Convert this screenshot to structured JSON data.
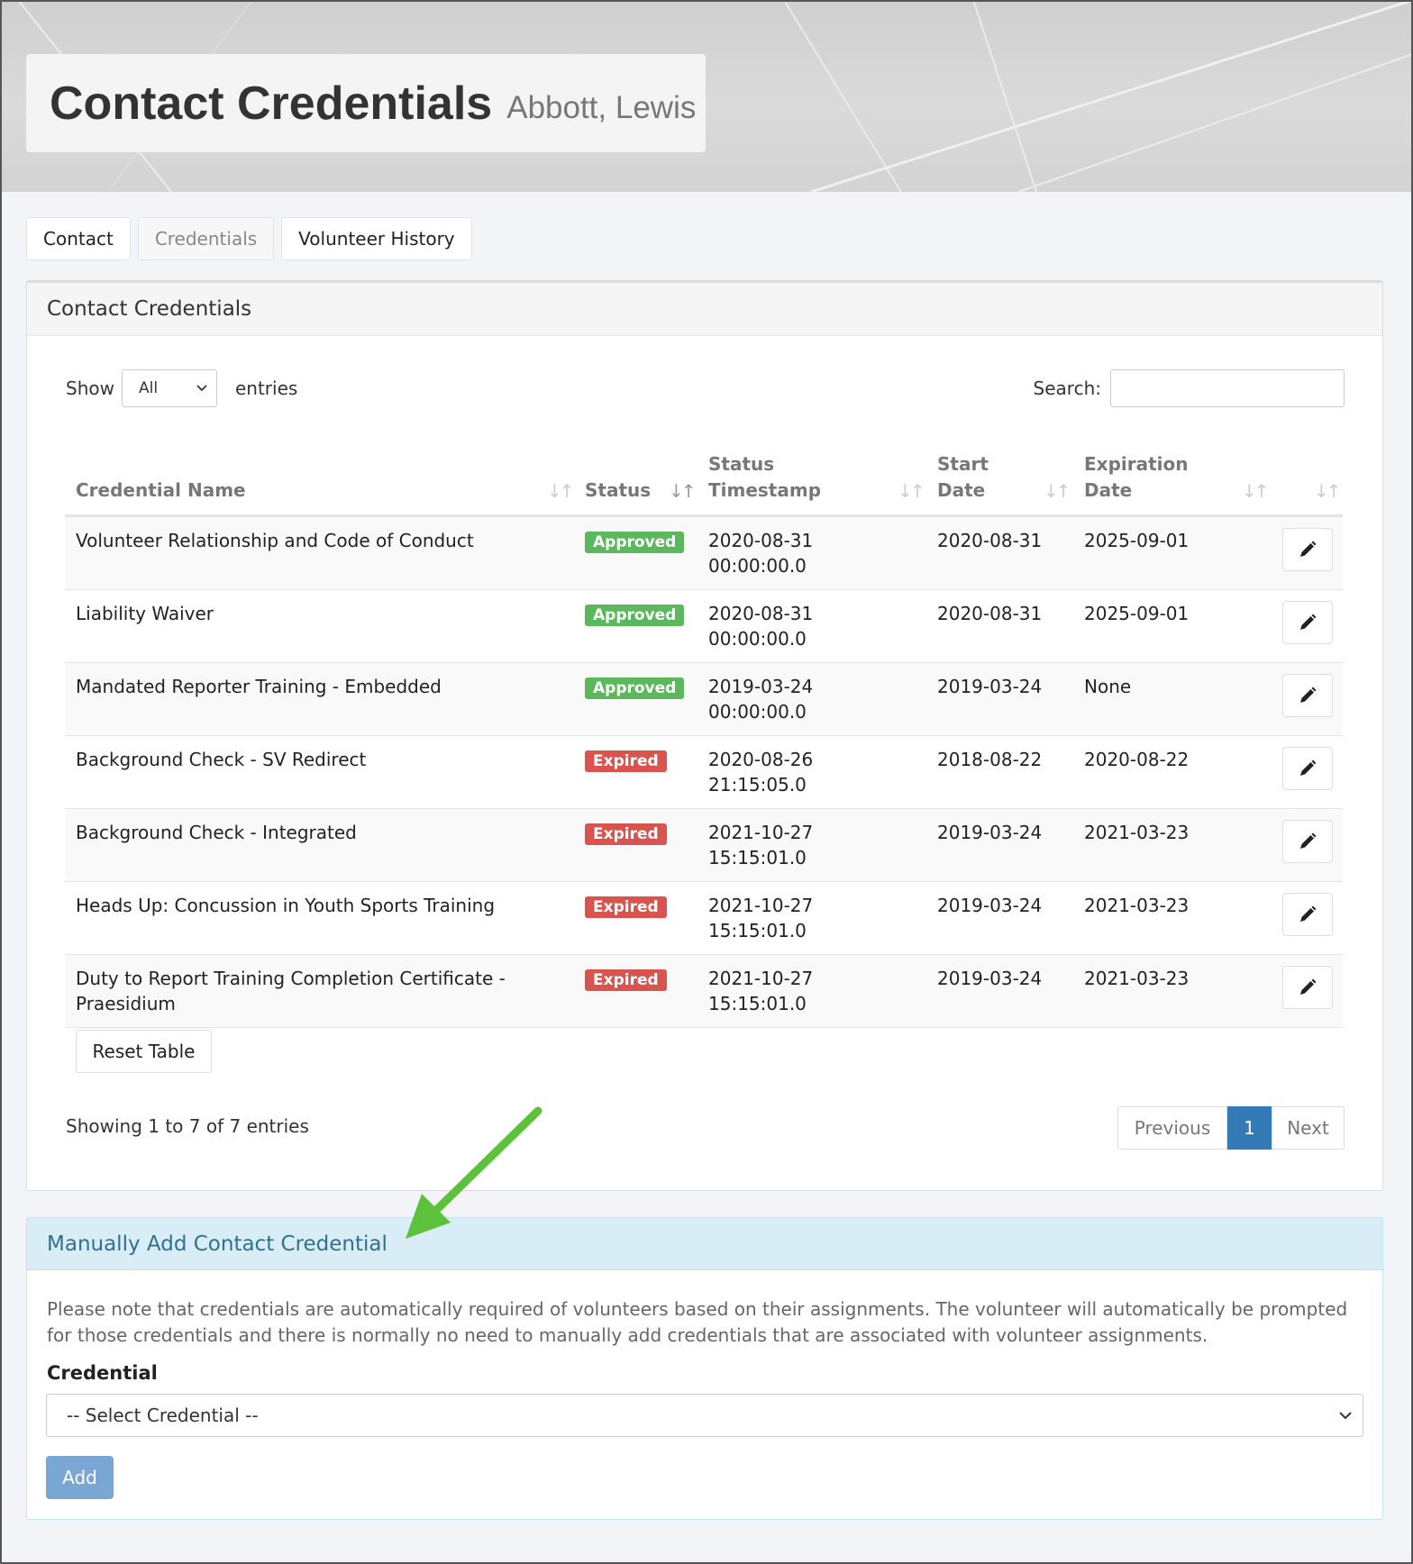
{
  "header": {
    "title": "Contact Credentials",
    "subtitle": "Abbott, Lewis"
  },
  "tabs": [
    {
      "label": "Contact",
      "active": false
    },
    {
      "label": "Credentials",
      "active": true
    },
    {
      "label": "Volunteer History",
      "active": false
    }
  ],
  "panel": {
    "title": "Contact Credentials",
    "show_label": "Show",
    "show_value": "All",
    "entries_label": "entries",
    "search_label": "Search:",
    "search_value": "",
    "columns": {
      "name": "Credential Name",
      "status": "Status",
      "timestamp_l1": "Status",
      "timestamp_l2": "Timestamp",
      "start_l1": "Start",
      "start_l2": "Date",
      "exp_l1": "Expiration",
      "exp_l2": "Date"
    },
    "rows": [
      {
        "name": "Volunteer Relationship and Code of Conduct",
        "status": "Approved",
        "ts_date": "2020-08-31",
        "ts_time": "00:00:00.0",
        "start": "2020-08-31",
        "expiration": "2025-09-01"
      },
      {
        "name": "Liability Waiver",
        "status": "Approved",
        "ts_date": "2020-08-31",
        "ts_time": "00:00:00.0",
        "start": "2020-08-31",
        "expiration": "2025-09-01"
      },
      {
        "name": "Mandated Reporter Training - Embedded",
        "status": "Approved",
        "ts_date": "2019-03-24",
        "ts_time": "00:00:00.0",
        "start": "2019-03-24",
        "expiration": "None"
      },
      {
        "name": "Background Check - SV Redirect",
        "status": "Expired",
        "ts_date": "2020-08-26",
        "ts_time": "21:15:05.0",
        "start": "2018-08-22",
        "expiration": "2020-08-22"
      },
      {
        "name": "Background Check - Integrated",
        "status": "Expired",
        "ts_date": "2021-10-27",
        "ts_time": "15:15:01.0",
        "start": "2019-03-24",
        "expiration": "2021-03-23"
      },
      {
        "name": "Heads Up: Concussion in Youth Sports Training",
        "status": "Expired",
        "ts_date": "2021-10-27",
        "ts_time": "15:15:01.0",
        "start": "2019-03-24",
        "expiration": "2021-03-23"
      },
      {
        "name_l1": "Duty to Report Training Completion Certificate -",
        "name_l2": "Praesidium",
        "status": "Expired",
        "ts_date": "2021-10-27",
        "ts_time": "15:15:01.0",
        "start": "2019-03-24",
        "expiration": "2021-03-23"
      }
    ],
    "reset_label": "Reset Table",
    "info": "Showing 1 to 7 of 7 entries",
    "pager": {
      "prev": "Previous",
      "page": "1",
      "next": "Next"
    }
  },
  "manual": {
    "title": "Manually Add Contact Credential",
    "note": "Please note that credentials are automatically required of volunteers based on their assignments. The volunteer will automatically be prompted for those credentials and there is normally no need to manually add credentials that are associated with volunteer assignments.",
    "credential_label": "Credential",
    "select_value": "-- Select Credential --",
    "add_label": "Add"
  },
  "colors": {
    "approved": "#5cb85c",
    "expired": "#d9534f",
    "primary": "#337ab7",
    "info_header": "#d9edf7",
    "annotation_arrow": "#5cc13b"
  },
  "icons": {
    "edit": "pencil-icon",
    "sort": "sort-icon",
    "dropdown": "chevron-down-icon",
    "annotation": "arrow-annotation-icon"
  }
}
